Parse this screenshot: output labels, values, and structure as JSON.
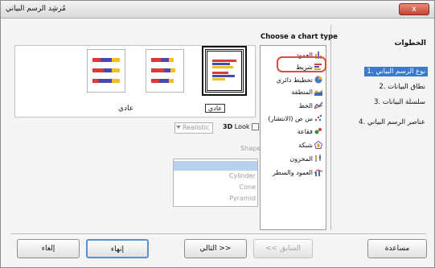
{
  "window": {
    "title": "مُرشِد الرسم البياني",
    "close_glyph": "x"
  },
  "steps": {
    "title": "الخطوات",
    "items": [
      {
        "label": "1. نوع الرسم البياني",
        "active": true
      },
      {
        "label": "2. نطاق البيانات",
        "active": false
      },
      {
        "label": "3. سلسلة البيانات",
        "active": false
      },
      {
        "label": "4. عناصر الرسم البياني",
        "active": false
      }
    ]
  },
  "chart_types": {
    "heading": "Choose a chart type",
    "items": [
      {
        "label": "العمود",
        "icon": "column-chart-icon",
        "color": "#c9a247"
      },
      {
        "label": "شريط",
        "icon": "bar-chart-icon",
        "color": "#d3403a",
        "selected": true
      },
      {
        "label": "تخطيط دائري",
        "icon": "pie-chart-icon",
        "color": "#3c7cc4"
      },
      {
        "label": "المنطقة",
        "icon": "area-chart-icon",
        "color": "#e0a231"
      },
      {
        "label": "الخط",
        "icon": "line-chart-icon",
        "color": "#3c6bb3"
      },
      {
        "label": "س ص (الانتشار)",
        "icon": "scatter-chart-icon",
        "color": "#6a4bb0"
      },
      {
        "label": "فقاعة",
        "icon": "bubble-chart-icon",
        "color": "#3b8e3b"
      },
      {
        "label": "شبكة",
        "icon": "net-chart-icon",
        "color": "#7a4aa8"
      },
      {
        "label": "المخزون",
        "icon": "stock-chart-icon",
        "color": "#e0a231"
      },
      {
        "label": "العمود والسطر",
        "icon": "column-line-chart-icon",
        "color": "#3c6bb3"
      }
    ]
  },
  "preview": {
    "variant_label": "عادي",
    "tooltip": "عادي",
    "colors": {
      "red": "#d93a3a",
      "blue": "#4a4aa8",
      "yellow": "#f0c020",
      "purple": "#8a3aa0"
    }
  },
  "options_3d": {
    "realistic_value": "Realistic",
    "look_prefix": "3D",
    "look_suffix": "Look",
    "shape_label": "Shape",
    "shapes": [
      "",
      "Cylinder",
      "Cone",
      "Pyramid"
    ]
  },
  "buttons": {
    "help": "مساعدة",
    "back": "<< السابق",
    "next": "التالي >>",
    "finish": "إنهاء",
    "cancel": "إلغاء"
  }
}
